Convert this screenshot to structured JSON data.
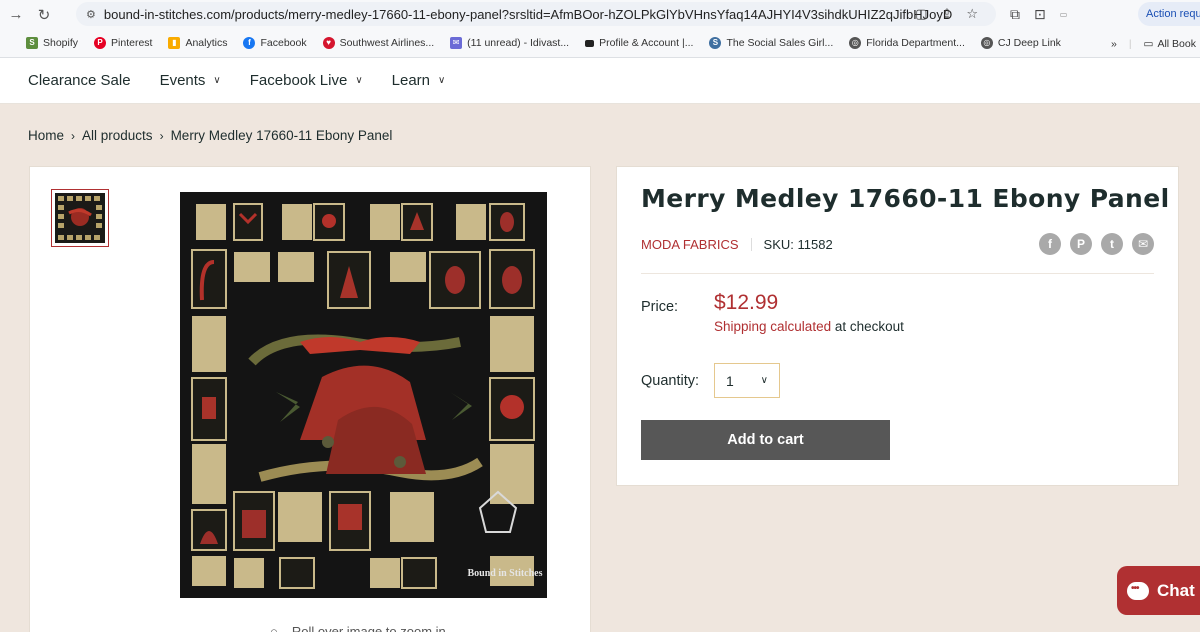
{
  "browser": {
    "url": "bound-in-stitches.com/products/merry-medley-17660-11-ebony-panel?srsltid=AfmBOor-hZOLPkGlYbVHnsYfaq14AJHYI4V3sihdkUHIZ2qJifbHJoyD",
    "action_label": "Action requir",
    "bookmarks": [
      {
        "label": "Shopify",
        "color": "#5e8e3e",
        "icon": "shopify-icon"
      },
      {
        "label": "Pinterest",
        "color": "#e60023",
        "icon": "pinterest-icon"
      },
      {
        "label": "Analytics",
        "color": "#f9ab00",
        "icon": "analytics-icon"
      },
      {
        "label": "Facebook",
        "color": "#1877f2",
        "icon": "facebook-icon"
      },
      {
        "label": "Southwest Airlines...",
        "color": "#d5152e",
        "icon": "southwest-icon"
      },
      {
        "label": "(11 unread) - Idivast...",
        "color": "#6b6bd6",
        "icon": "mail-icon"
      },
      {
        "label": "Profile & Account |...",
        "color": "#222222",
        "icon": "profile-icon"
      },
      {
        "label": "The Social Sales Girl...",
        "color": "#3f6fa0",
        "icon": "social-icon"
      },
      {
        "label": "Florida Department...",
        "color": "#555555",
        "icon": "globe-icon"
      },
      {
        "label": "CJ Deep Link",
        "color": "#555555",
        "icon": "globe-icon"
      }
    ],
    "more_label": "»",
    "all_bookmarks": "All Book"
  },
  "nav": {
    "items": [
      {
        "label": "Clearance Sale",
        "dropdown": false
      },
      {
        "label": "Events",
        "dropdown": true
      },
      {
        "label": "Facebook Live",
        "dropdown": true
      },
      {
        "label": "Learn",
        "dropdown": true
      }
    ]
  },
  "breadcrumb": {
    "home": "Home",
    "all_products": "All products",
    "current": "Merry Medley 17660-11 Ebony Panel"
  },
  "product": {
    "title": "Merry Medley 17660-11 Ebony Panel",
    "vendor": "MODA FABRICS",
    "sku": "SKU: 11582",
    "price_label": "Price:",
    "price": "$12.99",
    "shipping_link": "Shipping calculated",
    "shipping_suffix": " at checkout",
    "quantity_label": "Quantity:",
    "quantity_value": "1",
    "add_to_cart": "Add to cart",
    "zoom_hint": "Roll over image to zoom in",
    "watermark": "Bound in Stitches"
  },
  "share": [
    "f",
    "P",
    "t",
    "✉"
  ],
  "chat": {
    "label": "Chat"
  }
}
